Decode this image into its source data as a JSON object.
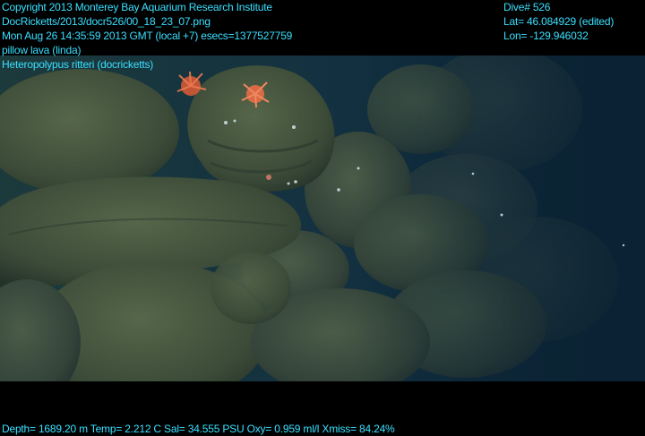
{
  "overlay": {
    "top_left": [
      "Copyright 2013 Monterey Bay Aquarium Research Institute",
      "DocRicketts/2013/docr526/00_18_23_07.png",
      "Mon Aug 26 14:35:59 2013 GMT (local +7)  esecs=1377527759",
      "pillow lava (linda)",
      "Heteropolypus ritteri (docricketts)"
    ],
    "top_right": [
      "Dive# 526",
      "Lat= 46.084929 (edited)",
      "Lon= -129.946032"
    ],
    "bottom": "Depth= 1689.20 m  Temp= 2.212 C  Sal= 34.555 PSU  Oxy= 0.959 ml/l  Xmiss= 84.24%"
  },
  "colors": {
    "overlay_text": "#39e0ff",
    "water": "#0f2c3a",
    "rock": "#3a4a35",
    "coral": "#e0603c"
  }
}
